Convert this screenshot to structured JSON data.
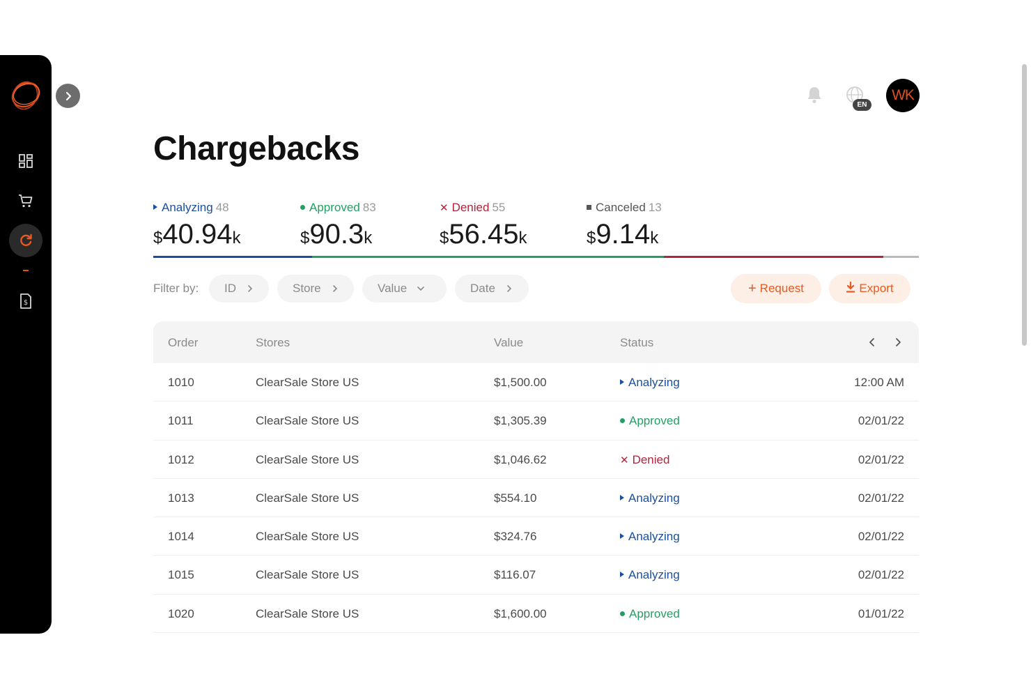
{
  "header": {
    "title": "Chargebacks",
    "notifications_icon": "bell-icon",
    "language": "EN",
    "avatar_initials": "WK"
  },
  "colors": {
    "accent": "#e85a20",
    "analyzing": "#1a4fa0",
    "approved": "#22a064",
    "denied": "#b0243c",
    "canceled": "#555555"
  },
  "sidebar": {
    "items": [
      {
        "name": "dashboard",
        "icon": "grid-icon"
      },
      {
        "name": "store",
        "icon": "cart-icon"
      },
      {
        "name": "chargebacks",
        "icon": "refresh-icon",
        "active": true
      },
      {
        "name": "reports",
        "icon": "document-dollar-icon"
      }
    ]
  },
  "summary": {
    "analyzing": {
      "label": "Analyzing",
      "count": "48",
      "currency": "$",
      "amount": "40.94",
      "unit": "k"
    },
    "approved": {
      "label": "Approved",
      "count": "83",
      "currency": "$",
      "amount": "90.3",
      "unit": "k"
    },
    "denied": {
      "label": "Denied",
      "count": "55",
      "currency": "$",
      "amount": "56.45",
      "unit": "k"
    },
    "canceled": {
      "label": "Canceled",
      "count": "13",
      "currency": "$",
      "amount": "9.14",
      "unit": "k"
    }
  },
  "filters": {
    "label": "Filter by:",
    "chips": [
      "ID",
      "Store",
      "Value",
      "Date"
    ]
  },
  "actions": {
    "request_label": "Request",
    "export_label": "Export"
  },
  "table": {
    "columns": [
      "Order",
      "Stores",
      "Value",
      "Status"
    ],
    "rows": [
      {
        "order": "1010",
        "store": "ClearSale Store US",
        "value": "$1,500.00",
        "status": "Analyzing",
        "date": "12:00 AM"
      },
      {
        "order": "1011",
        "store": "ClearSale Store US",
        "value": "$1,305.39",
        "status": "Approved",
        "date": "02/01/22"
      },
      {
        "order": "1012",
        "store": "ClearSale Store US",
        "value": "$1,046.62",
        "status": "Denied",
        "date": "02/01/22"
      },
      {
        "order": "1013",
        "store": "ClearSale Store US",
        "value": "$554.10",
        "status": "Analyzing",
        "date": "02/01/22"
      },
      {
        "order": "1014",
        "store": "ClearSale Store US",
        "value": "$324.76",
        "status": "Analyzing",
        "date": "02/01/22"
      },
      {
        "order": "1015",
        "store": "ClearSale Store US",
        "value": "$116.07",
        "status": "Analyzing",
        "date": "02/01/22"
      },
      {
        "order": "1020",
        "store": "ClearSale Store US",
        "value": "$1,600.00",
        "status": "Approved",
        "date": "01/01/22"
      }
    ]
  }
}
